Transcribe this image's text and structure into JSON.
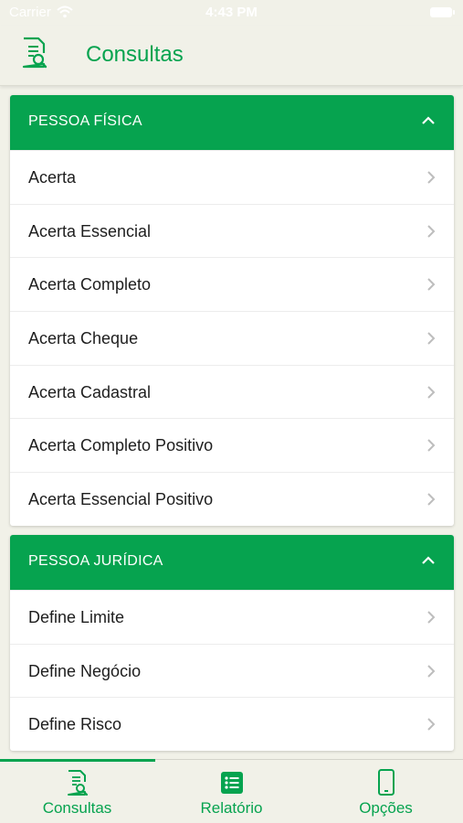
{
  "status_bar": {
    "carrier": "Carrier",
    "time": "4:43 PM"
  },
  "header": {
    "title": "Consultas",
    "icon": "document-search-icon"
  },
  "sections": [
    {
      "title": "PESSOA FÍSICA",
      "items": [
        "Acerta",
        "Acerta Essencial",
        "Acerta Completo",
        "Acerta Cheque",
        "Acerta Cadastral",
        "Acerta Completo Positivo",
        "Acerta Essencial Positivo"
      ]
    },
    {
      "title": "PESSOA JURÍDICA",
      "items": [
        "Define Limite",
        "Define Negócio",
        "Define Risco"
      ]
    }
  ],
  "tabs": [
    {
      "label": "Consultas",
      "icon": "document-search-icon",
      "active": true
    },
    {
      "label": "Relatório",
      "icon": "list-icon",
      "active": false
    },
    {
      "label": "Opções",
      "icon": "phone-icon",
      "active": false
    }
  ],
  "colors": {
    "brand": "#06a34f",
    "background": "#f1f1e8"
  }
}
